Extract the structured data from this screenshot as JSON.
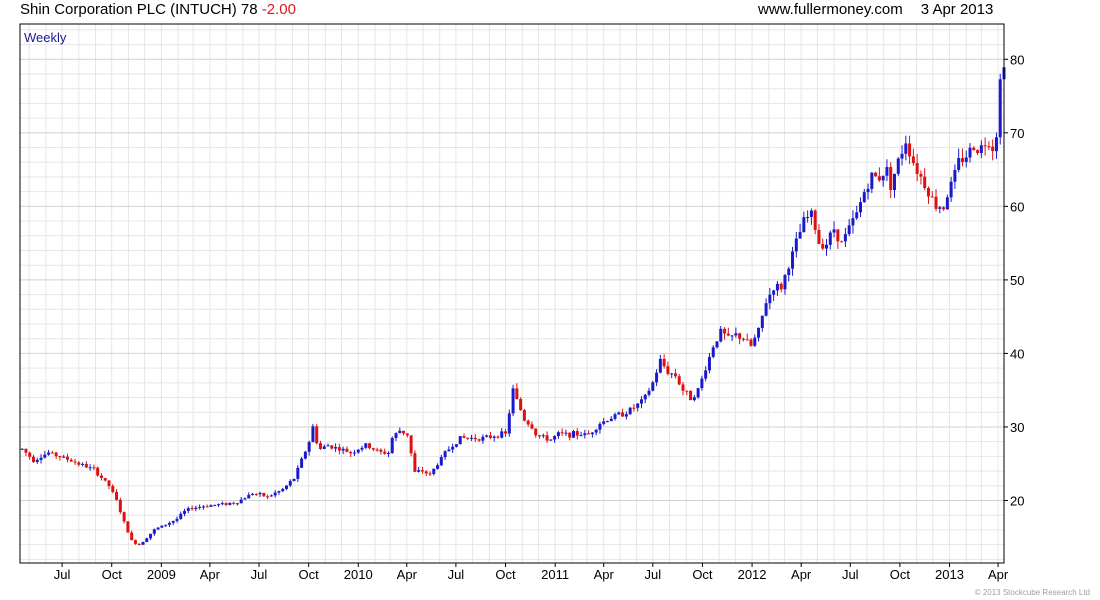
{
  "header": {
    "name": "Shin Corporation PLC (INTUCH)",
    "price": "78",
    "change": "-2.00",
    "website": "www.fullermoney.com",
    "date": "3 Apr 2013"
  },
  "footer": "© 2013 Stockcube Research Ltd",
  "colors": {
    "up": "#1a1acc",
    "down": "#dd1111",
    "grid": "#e6e6e6",
    "frame": "#000000",
    "period_label": "#1a1a99"
  },
  "chart_data": {
    "type": "candlestick",
    "period_label": "Weekly",
    "y_axis": {
      "position": "right",
      "ticks": [
        20,
        30,
        40,
        50,
        60,
        70,
        80
      ],
      "ylim": [
        11.5,
        84.8
      ]
    },
    "x_axis": {
      "xlim": [
        "2008-04-14",
        "2013-04-12"
      ],
      "ticks": [
        {
          "label": "Jul",
          "date": "2008-07-01"
        },
        {
          "label": "Oct",
          "date": "2008-10-01"
        },
        {
          "label": "2009",
          "date": "2009-01-01"
        },
        {
          "label": "Apr",
          "date": "2009-04-01"
        },
        {
          "label": "Jul",
          "date": "2009-07-01"
        },
        {
          "label": "Oct",
          "date": "2009-10-01"
        },
        {
          "label": "2010",
          "date": "2010-01-01"
        },
        {
          "label": "Apr",
          "date": "2010-04-01"
        },
        {
          "label": "Jul",
          "date": "2010-07-01"
        },
        {
          "label": "Oct",
          "date": "2010-10-01"
        },
        {
          "label": "2011",
          "date": "2011-01-01"
        },
        {
          "label": "Apr",
          "date": "2011-04-01"
        },
        {
          "label": "Jul",
          "date": "2011-07-01"
        },
        {
          "label": "Oct",
          "date": "2011-10-01"
        },
        {
          "label": "2012",
          "date": "2012-01-01"
        },
        {
          "label": "Apr",
          "date": "2012-04-01"
        },
        {
          "label": "Jul",
          "date": "2012-07-01"
        },
        {
          "label": "Oct",
          "date": "2012-10-01"
        },
        {
          "label": "2013",
          "date": "2013-01-01"
        },
        {
          "label": "Apr",
          "date": "2013-04-01"
        }
      ]
    },
    "grid": true,
    "close_path": {
      "dates": [
        "2008-04-18",
        "2008-05-09",
        "2008-06-06",
        "2008-07-04",
        "2008-08-01",
        "2008-08-29",
        "2008-09-26",
        "2008-10-10",
        "2008-10-24",
        "2008-11-07",
        "2008-11-21",
        "2008-12-05",
        "2008-12-19",
        "2009-01-02",
        "2009-01-16",
        "2009-01-30",
        "2009-02-13",
        "2009-02-27",
        "2009-03-27",
        "2009-04-24",
        "2009-05-22",
        "2009-06-19",
        "2009-07-17",
        "2009-08-14",
        "2009-09-04",
        "2009-09-18",
        "2009-10-02",
        "2009-10-09",
        "2009-10-16",
        "2009-10-23",
        "2009-11-06",
        "2009-11-27",
        "2009-12-18",
        "2010-01-15",
        "2010-02-12",
        "2010-02-26",
        "2010-03-05",
        "2010-03-19",
        "2010-04-02",
        "2010-04-16",
        "2010-04-30",
        "2010-05-14",
        "2010-05-28",
        "2010-06-11",
        "2010-06-25",
        "2010-07-09",
        "2010-07-23",
        "2010-08-06",
        "2010-08-27",
        "2010-09-17",
        "2010-10-01",
        "2010-10-15",
        "2010-11-05",
        "2010-11-19",
        "2010-11-26",
        "2010-12-10",
        "2010-12-24",
        "2011-01-07",
        "2011-01-21",
        "2011-02-11",
        "2011-03-04",
        "2011-03-25",
        "2011-04-08",
        "2011-04-22",
        "2011-05-13",
        "2011-06-03",
        "2011-06-17",
        "2011-07-01",
        "2011-07-15",
        "2011-07-29",
        "2011-08-12",
        "2011-08-26",
        "2011-09-09",
        "2011-09-23",
        "2011-10-07",
        "2011-10-21",
        "2011-11-04",
        "2011-11-18",
        "2011-12-02",
        "2011-12-16",
        "2011-12-30",
        "2012-01-13",
        "2012-01-27",
        "2012-02-10",
        "2012-02-24",
        "2012-03-09",
        "2012-03-23",
        "2012-04-06",
        "2012-04-20",
        "2012-05-04",
        "2012-05-18",
        "2012-06-01",
        "2012-06-15",
        "2012-06-29",
        "2012-07-13",
        "2012-07-27",
        "2012-08-10",
        "2012-08-24",
        "2012-09-07",
        "2012-09-14",
        "2012-09-28",
        "2012-10-12",
        "2012-10-26",
        "2012-11-09",
        "2012-11-23",
        "2012-12-07",
        "2012-12-21",
        "2013-01-04",
        "2013-01-18",
        "2013-02-01",
        "2013-02-15",
        "2013-03-01",
        "2013-03-15",
        "2013-03-22",
        "2013-03-29",
        "2013-04-05",
        "2013-04-12"
      ],
      "closes": [
        27,
        25.5,
        26.5,
        25.8,
        25,
        24.2,
        22,
        20,
        17,
        14.5,
        14,
        15,
        16,
        16.5,
        17,
        17.5,
        18.5,
        19,
        19.3,
        19.5,
        19.8,
        21,
        20.5,
        21.5,
        23,
        25.5,
        28,
        30,
        28,
        27,
        27.5,
        27,
        26.5,
        27.5,
        26.5,
        26.5,
        28.5,
        29.5,
        29,
        23.8,
        24,
        23.5,
        25,
        26.5,
        27.5,
        28.5,
        28.5,
        28.5,
        28.5,
        29,
        29,
        35,
        31,
        30,
        29,
        28.5,
        28.3,
        29,
        29,
        29,
        29,
        30.5,
        31,
        31.5,
        32,
        33,
        34,
        36,
        39,
        37.5,
        37,
        35,
        34,
        35,
        38,
        41,
        43,
        42,
        42.5,
        42,
        41,
        43,
        47,
        49,
        49,
        52,
        55,
        58,
        59,
        55,
        55,
        57,
        55,
        57,
        59,
        62,
        64,
        64,
        65,
        63,
        66,
        69,
        66,
        64,
        62,
        60,
        60,
        63,
        66,
        67,
        68,
        68,
        69,
        68,
        70,
        77,
        80,
        78,
        78
      ]
    }
  }
}
